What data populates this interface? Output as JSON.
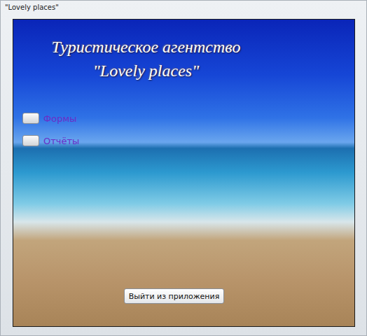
{
  "window": {
    "title": "\"Lovely places\""
  },
  "header": {
    "lines": [
      "Туристическое агентство",
      "\"Lovely places\""
    ]
  },
  "menu": [
    {
      "label": "Формы"
    },
    {
      "label": "Отчёты"
    }
  ],
  "buttons": [
    "Выйти из приложения"
  ]
}
